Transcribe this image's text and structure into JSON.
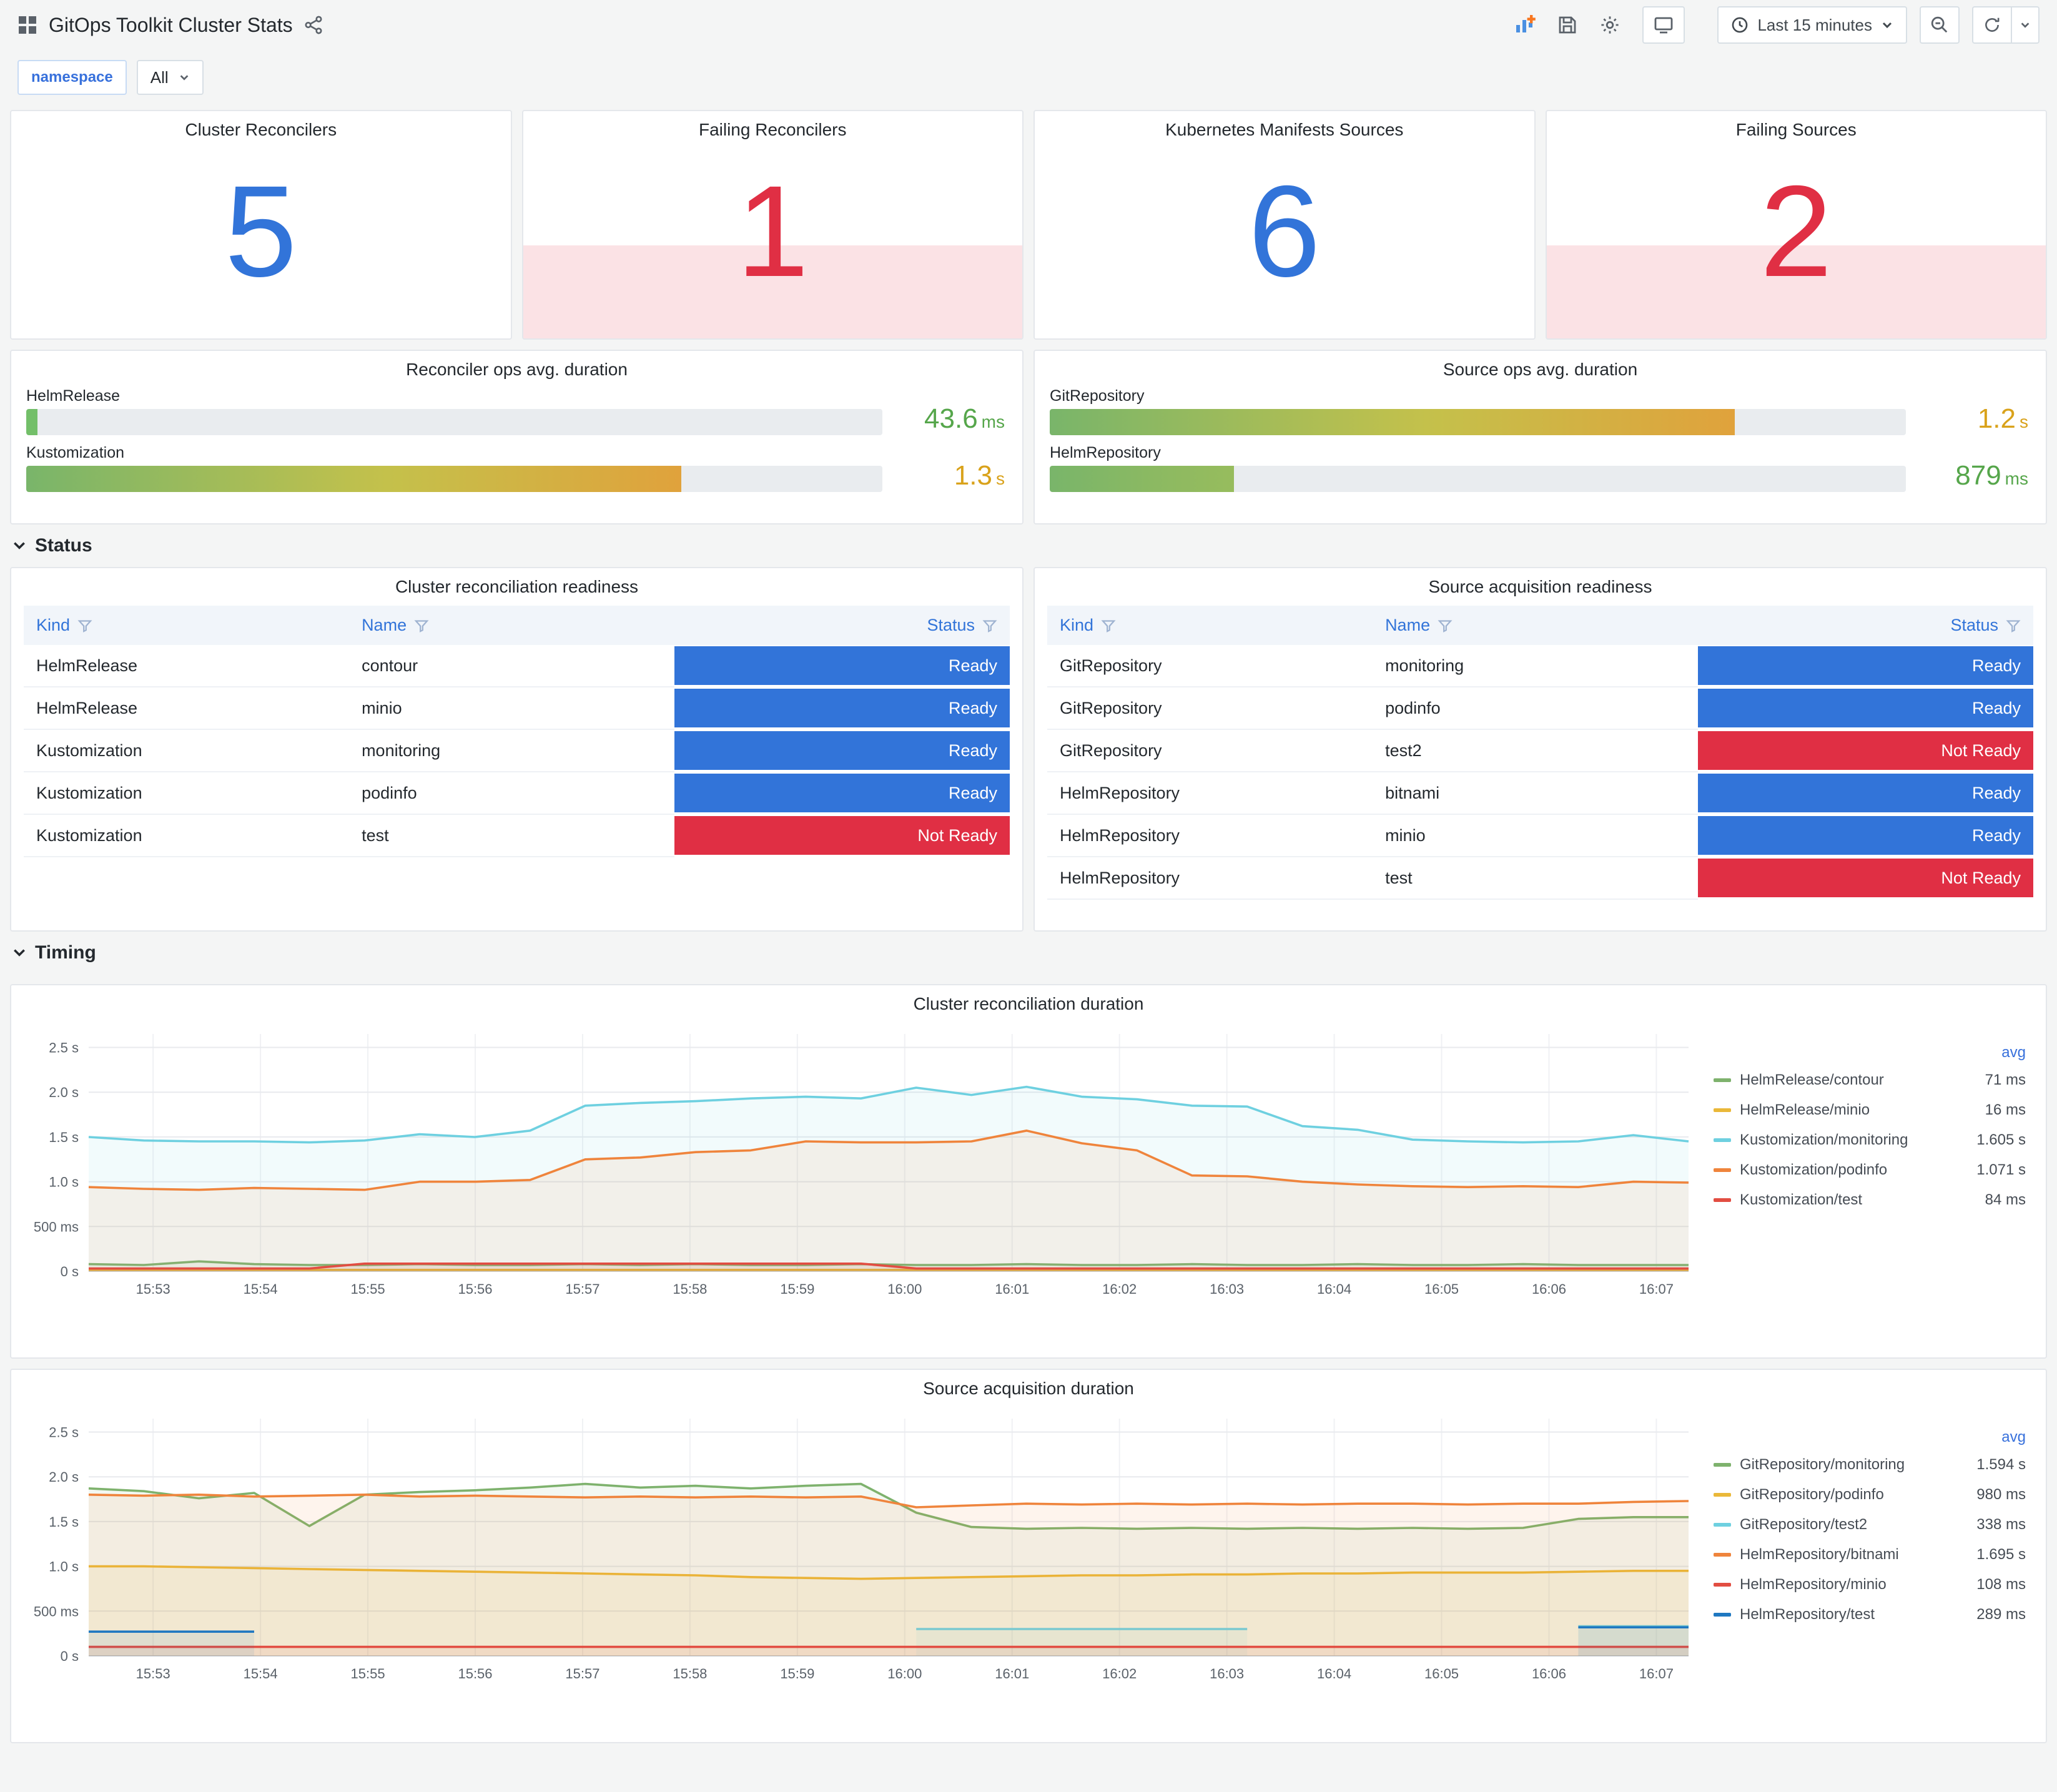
{
  "colors": {
    "primary": "#3274D9",
    "alert": "#E02F44",
    "ready": "#3274D9",
    "not_ready": "#E02F44",
    "green_value": "#56A64B",
    "amber_value": "#D9A21B"
  },
  "header": {
    "title": "GitOps Toolkit Cluster Stats",
    "time_range": "Last 15 minutes",
    "icons": [
      "apps-grid-icon",
      "share-icon",
      "panel-add-icon",
      "save-icon",
      "settings-gear-icon",
      "tv-icon",
      "clock-icon",
      "zoom-out-icon",
      "refresh-icon",
      "caret-down-icon"
    ]
  },
  "filters": {
    "name": "namespace",
    "value": "All"
  },
  "sections": {
    "status": "Status",
    "timing": "Timing"
  },
  "stats": [
    {
      "title": "Cluster Reconcilers",
      "value": "5",
      "state": "ok"
    },
    {
      "title": "Failing Reconcilers",
      "value": "1",
      "state": "alert"
    },
    {
      "title": "Kubernetes Manifests Sources",
      "value": "6",
      "state": "ok"
    },
    {
      "title": "Failing Sources",
      "value": "2",
      "state": "alert"
    }
  ],
  "gauges": [
    {
      "title": "Reconciler ops avg. duration",
      "rows": [
        {
          "label": "HelmRelease",
          "value": "43.6",
          "unit": "ms",
          "fraction": 0.013,
          "value_color": "#56A64B",
          "bar_start": "#73BF69",
          "bar_mid": "#73BF69",
          "bar_end": "#73BF69"
        },
        {
          "label": "Kustomization",
          "value": "1.3",
          "unit": "s",
          "fraction": 0.765,
          "value_color": "#D9A21B",
          "bar_start": "#79B56A",
          "bar_mid": "#C4C14B",
          "bar_end": "#E0A23C"
        }
      ]
    },
    {
      "title": "Source ops avg. duration",
      "rows": [
        {
          "label": "GitRepository",
          "value": "1.2",
          "unit": "s",
          "fraction": 0.8,
          "value_color": "#D9A21B",
          "bar_start": "#79B56A",
          "bar_mid": "#C4C14B",
          "bar_end": "#E0A23C"
        },
        {
          "label": "HelmRepository",
          "value": "879",
          "unit": "ms",
          "fraction": 0.215,
          "value_color": "#56A64B",
          "bar_start": "#79B56A",
          "bar_mid": "#8BB962",
          "bar_end": "#97BC5D"
        }
      ]
    }
  ],
  "tables": [
    {
      "title": "Cluster reconciliation readiness",
      "columns": [
        "Kind",
        "Name",
        "Status"
      ],
      "rows": [
        [
          "HelmRelease",
          "contour",
          "Ready"
        ],
        [
          "HelmRelease",
          "minio",
          "Ready"
        ],
        [
          "Kustomization",
          "monitoring",
          "Ready"
        ],
        [
          "Kustomization",
          "podinfo",
          "Ready"
        ],
        [
          "Kustomization",
          "test",
          "Not Ready"
        ]
      ]
    },
    {
      "title": "Source acquisition readiness",
      "columns": [
        "Kind",
        "Name",
        "Status"
      ],
      "rows": [
        [
          "GitRepository",
          "monitoring",
          "Ready"
        ],
        [
          "GitRepository",
          "podinfo",
          "Ready"
        ],
        [
          "GitRepository",
          "test2",
          "Not Ready"
        ],
        [
          "HelmRepository",
          "bitnami",
          "Ready"
        ],
        [
          "HelmRepository",
          "minio",
          "Ready"
        ],
        [
          "HelmRepository",
          "test",
          "Not Ready"
        ]
      ]
    }
  ],
  "chart_data": [
    {
      "type": "line",
      "title": "Cluster reconciliation duration",
      "legend_header": "avg",
      "legend_position": "right",
      "grid": true,
      "ylim": [
        0,
        2.65
      ],
      "y_ticks": [
        {
          "v": 0,
          "label": "0 s"
        },
        {
          "v": 0.5,
          "label": "500 ms"
        },
        {
          "v": 1,
          "label": "1.0 s"
        },
        {
          "v": 1.5,
          "label": "1.5 s"
        },
        {
          "v": 2,
          "label": "2.0 s"
        },
        {
          "v": 2.5,
          "label": "2.5 s"
        }
      ],
      "x_ticks": [
        "15:53",
        "15:54",
        "15:55",
        "15:56",
        "15:57",
        "15:58",
        "15:59",
        "16:00",
        "16:01",
        "16:02",
        "16:03",
        "16:04",
        "16:05",
        "16:06",
        "16:07"
      ],
      "series": [
        {
          "name": "HelmRelease/contour",
          "avg": "71 ms",
          "color": "#7EB26D",
          "values": [
            0.08,
            0.07,
            0.11,
            0.08,
            0.07,
            0.07,
            0.08,
            0.07,
            0.07,
            0.08,
            0.07,
            0.08,
            0.07,
            0.07,
            0.08,
            0.07,
            0.07,
            0.08,
            0.07,
            0.07,
            0.08,
            0.07,
            0.07,
            0.08,
            0.07,
            0.07,
            0.08,
            0.07,
            0.07,
            0.07
          ]
        },
        {
          "name": "HelmRelease/minio",
          "avg": "16 ms",
          "color": "#EAB839",
          "values": [
            0.016,
            0.016,
            0.016,
            0.016,
            0.016,
            0.016,
            0.016,
            0.016,
            0.016,
            0.016,
            0.016,
            0.016,
            0.016,
            0.016,
            0.016,
            0.016,
            0.016,
            0.016,
            0.016,
            0.016,
            0.016,
            0.016,
            0.016,
            0.016,
            0.016,
            0.016,
            0.016,
            0.016,
            0.016,
            0.016
          ]
        },
        {
          "name": "Kustomization/monitoring",
          "avg": "1.605 s",
          "color": "#6ED0E0",
          "values": [
            1.5,
            1.46,
            1.45,
            1.45,
            1.44,
            1.46,
            1.53,
            1.5,
            1.57,
            1.85,
            1.88,
            1.9,
            1.93,
            1.95,
            1.93,
            2.05,
            1.97,
            2.06,
            1.95,
            1.92,
            1.85,
            1.84,
            1.62,
            1.58,
            1.47,
            1.45,
            1.44,
            1.45,
            1.52,
            1.45
          ]
        },
        {
          "name": "Kustomization/podinfo",
          "avg": "1.071 s",
          "color": "#EF843C",
          "values": [
            0.94,
            0.92,
            0.91,
            0.93,
            0.92,
            0.91,
            1.0,
            1.0,
            1.02,
            1.25,
            1.27,
            1.33,
            1.35,
            1.45,
            1.44,
            1.44,
            1.45,
            1.57,
            1.43,
            1.35,
            1.07,
            1.06,
            1.0,
            0.97,
            0.95,
            0.94,
            0.95,
            0.94,
            1.0,
            0.99
          ]
        },
        {
          "name": "Kustomization/test",
          "avg": "84 ms",
          "color": "#E24D42",
          "values": [
            0.03,
            0.03,
            0.03,
            0.03,
            0.03,
            0.085,
            0.085,
            0.085,
            0.085,
            0.085,
            0.085,
            0.085,
            0.085,
            0.085,
            0.085,
            0.03,
            0.03,
            0.03,
            0.03,
            0.03,
            0.03,
            0.03,
            0.03,
            0.03,
            0.03,
            0.03,
            0.03,
            0.03,
            0.03,
            0.03
          ]
        }
      ]
    },
    {
      "type": "line",
      "title": "Source acquisition duration",
      "legend_header": "avg",
      "legend_position": "right",
      "grid": true,
      "ylim": [
        0,
        2.65
      ],
      "y_ticks": [
        {
          "v": 0,
          "label": "0 s"
        },
        {
          "v": 0.5,
          "label": "500 ms"
        },
        {
          "v": 1,
          "label": "1.0 s"
        },
        {
          "v": 1.5,
          "label": "1.5 s"
        },
        {
          "v": 2,
          "label": "2.0 s"
        },
        {
          "v": 2.5,
          "label": "2.5 s"
        }
      ],
      "x_ticks": [
        "15:53",
        "15:54",
        "15:55",
        "15:56",
        "15:57",
        "15:58",
        "15:59",
        "16:00",
        "16:01",
        "16:02",
        "16:03",
        "16:04",
        "16:05",
        "16:06",
        "16:07"
      ],
      "series": [
        {
          "name": "GitRepository/monitoring",
          "avg": "1.594 s",
          "color": "#7EB26D",
          "values": [
            1.87,
            1.84,
            1.76,
            1.82,
            1.45,
            1.8,
            1.83,
            1.85,
            1.88,
            1.92,
            1.88,
            1.9,
            1.87,
            1.9,
            1.92,
            1.6,
            1.44,
            1.42,
            1.43,
            1.42,
            1.43,
            1.42,
            1.43,
            1.42,
            1.43,
            1.42,
            1.43,
            1.53,
            1.55,
            1.55
          ]
        },
        {
          "name": "GitRepository/podinfo",
          "avg": "980 ms",
          "color": "#EAB839",
          "values": [
            1.0,
            1.0,
            0.99,
            0.98,
            0.97,
            0.96,
            0.95,
            0.94,
            0.93,
            0.92,
            0.91,
            0.9,
            0.88,
            0.87,
            0.86,
            0.87,
            0.88,
            0.89,
            0.9,
            0.9,
            0.91,
            0.91,
            0.92,
            0.92,
            0.93,
            0.93,
            0.93,
            0.94,
            0.95,
            0.95
          ]
        },
        {
          "name": "GitRepository/test2",
          "avg": "338 ms",
          "color": "#6ED0E0",
          "values": [
            null,
            null,
            null,
            null,
            null,
            null,
            null,
            null,
            null,
            null,
            null,
            null,
            null,
            null,
            null,
            0.3,
            0.3,
            0.3,
            0.3,
            0.3,
            0.3,
            0.3,
            null,
            null,
            null,
            null,
            null,
            0.33,
            0.33,
            0.33
          ]
        },
        {
          "name": "HelmRepository/bitnami",
          "avg": "1.695 s",
          "color": "#EF843C",
          "values": [
            1.8,
            1.79,
            1.8,
            1.78,
            1.79,
            1.8,
            1.78,
            1.79,
            1.78,
            1.77,
            1.78,
            1.77,
            1.78,
            1.77,
            1.78,
            1.66,
            1.68,
            1.7,
            1.69,
            1.7,
            1.69,
            1.7,
            1.69,
            1.7,
            1.7,
            1.69,
            1.7,
            1.7,
            1.72,
            1.73
          ]
        },
        {
          "name": "HelmRepository/minio",
          "avg": "108 ms",
          "color": "#E24D42",
          "values": [
            0.1,
            0.1,
            0.1,
            0.1,
            0.1,
            0.1,
            0.1,
            0.1,
            0.1,
            0.1,
            0.1,
            0.1,
            0.1,
            0.1,
            0.1,
            0.1,
            0.1,
            0.1,
            0.1,
            0.1,
            0.1,
            0.1,
            0.1,
            0.1,
            0.1,
            0.1,
            0.1,
            0.1,
            0.1,
            0.1
          ]
        },
        {
          "name": "HelmRepository/test",
          "avg": "289 ms",
          "color": "#1F78C1",
          "values": [
            0.27,
            0.27,
            0.27,
            0.27,
            null,
            null,
            null,
            null,
            null,
            null,
            null,
            null,
            null,
            null,
            null,
            null,
            null,
            null,
            null,
            null,
            null,
            null,
            null,
            null,
            null,
            null,
            null,
            0.32,
            0.32,
            0.32
          ]
        }
      ]
    }
  ]
}
